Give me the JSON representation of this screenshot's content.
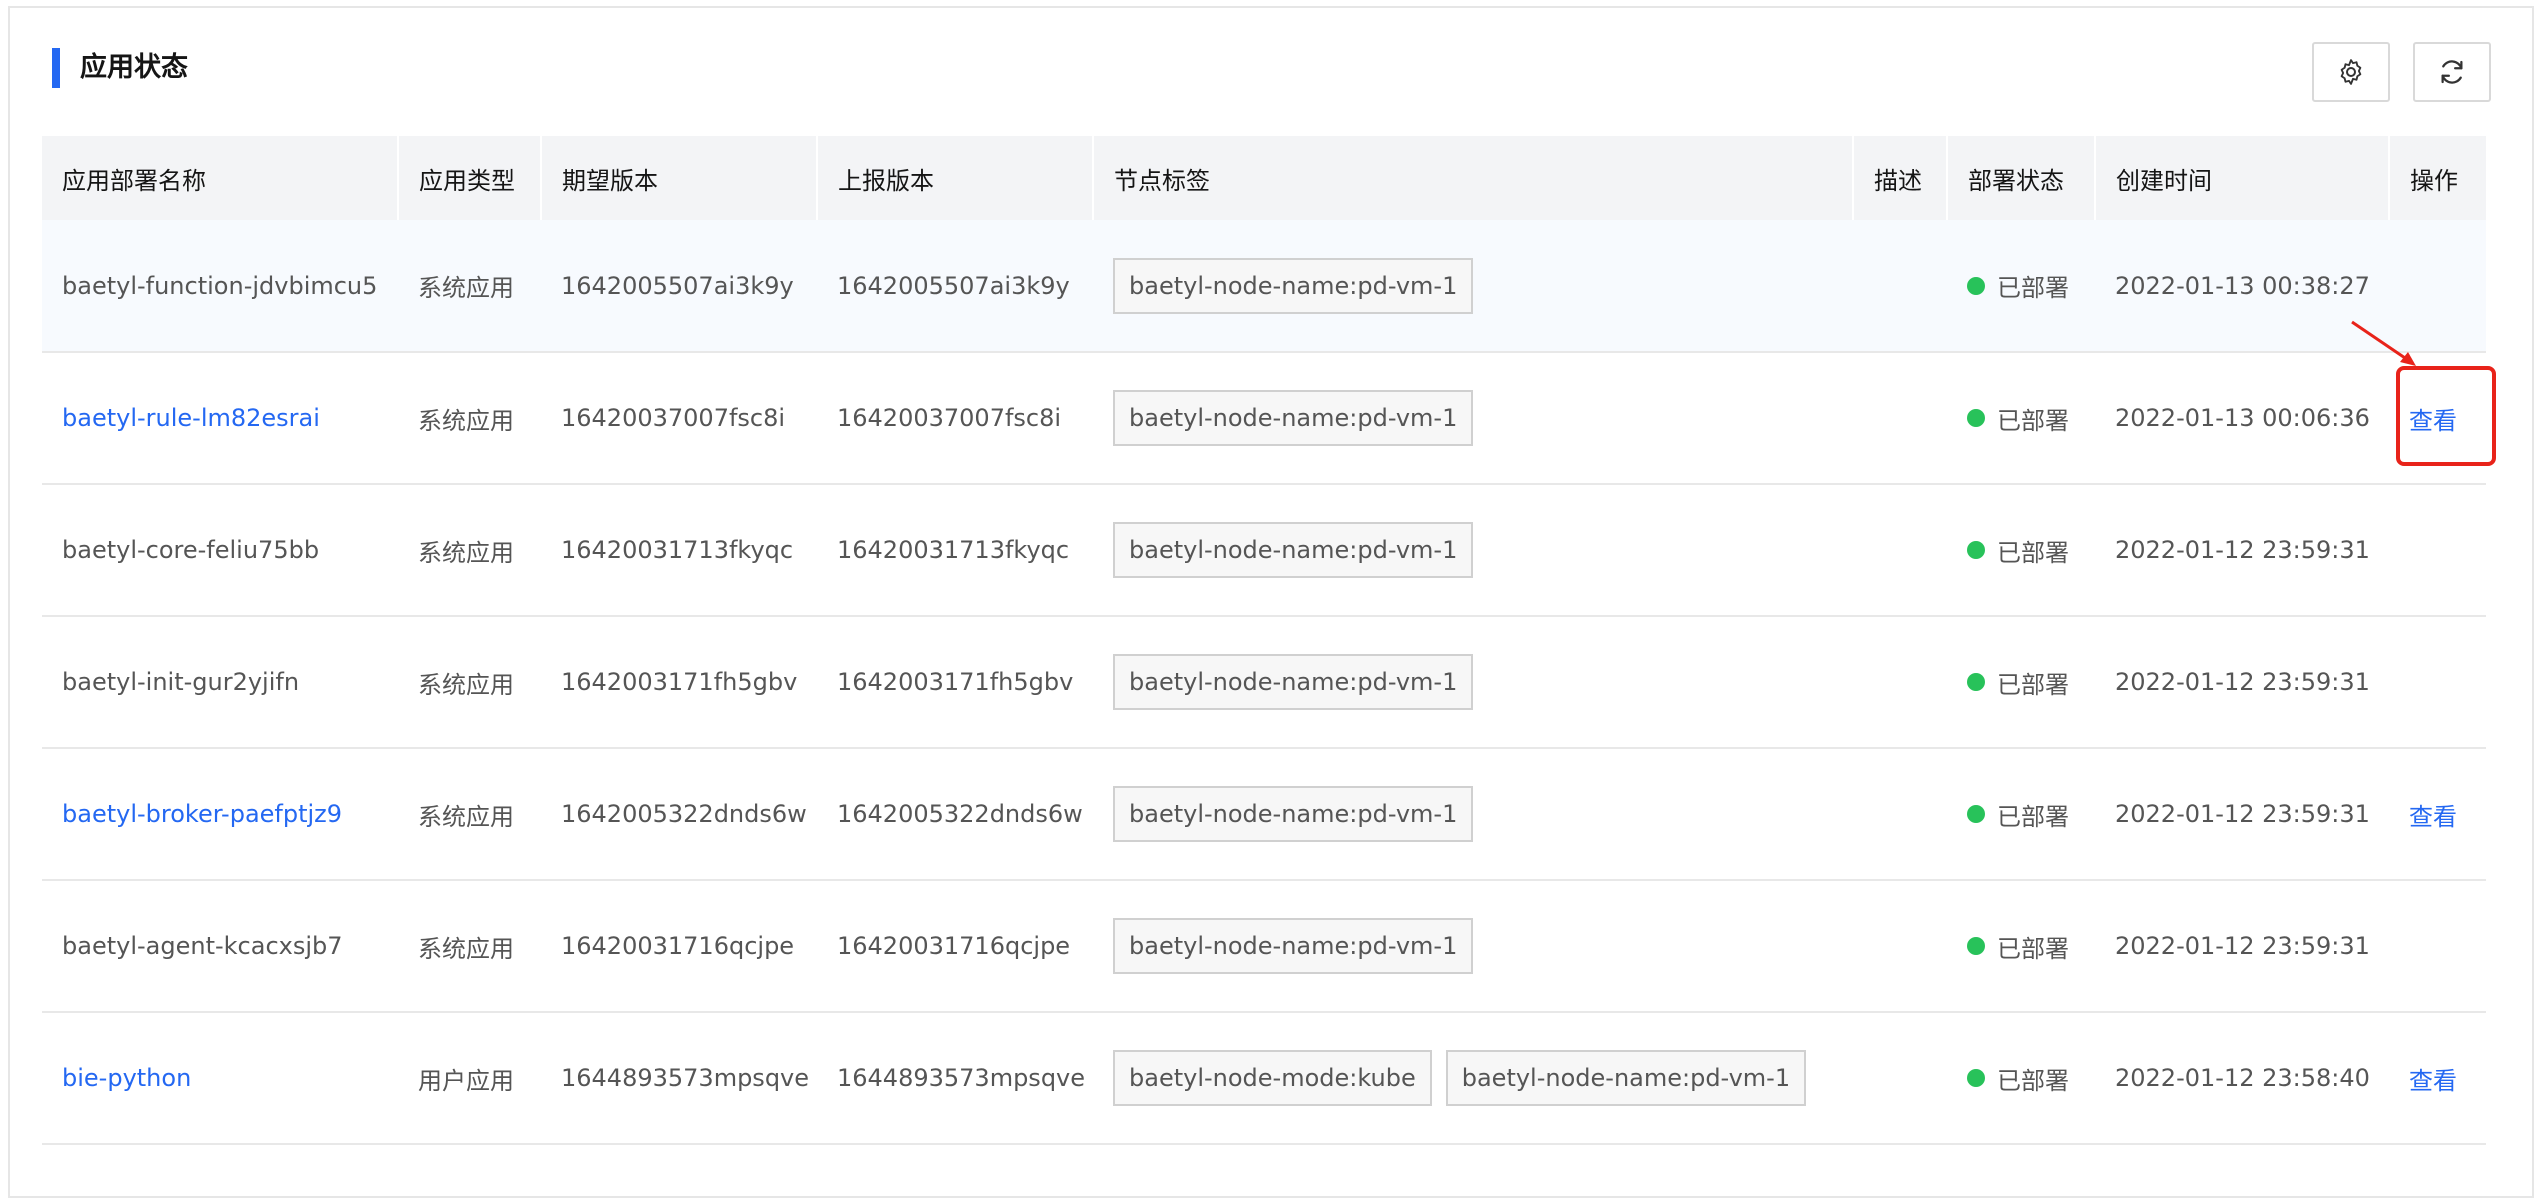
{
  "panel": {
    "title": "应用状态",
    "settings_icon": "gear-icon",
    "refresh_icon": "refresh-icon"
  },
  "table": {
    "headers": [
      "应用部署名称",
      "应用类型",
      "期望版本",
      "上报版本",
      "节点标签",
      "描述",
      "部署状态",
      "创建时间",
      "操作"
    ],
    "rows": [
      {
        "name": "baetyl-function-jdvbimcu5",
        "type": "系统应用",
        "expected": "1642005507ai3k9y",
        "reported": "1642005507ai3k9y",
        "tags": [
          "baetyl-node-name:pd-vm-1"
        ],
        "status": "已部署",
        "created": "2022-01-13 00:38:27",
        "action": ""
      },
      {
        "name": "baetyl-rule-lm82esrai",
        "type": "系统应用",
        "expected": "16420037007fsc8i",
        "reported": "16420037007fsc8i",
        "tags": [
          "baetyl-node-name:pd-vm-1"
        ],
        "status": "已部署",
        "created": "2022-01-13 00:06:36",
        "action": "查看"
      },
      {
        "name": "baetyl-core-feliu75bb",
        "type": "系统应用",
        "expected": "16420031713fkyqc",
        "reported": "16420031713fkyqc",
        "tags": [
          "baetyl-node-name:pd-vm-1"
        ],
        "status": "已部署",
        "created": "2022-01-12 23:59:31",
        "action": ""
      },
      {
        "name": "baetyl-init-gur2yjifn",
        "type": "系统应用",
        "expected": "1642003171fh5gbv",
        "reported": "1642003171fh5gbv",
        "tags": [
          "baetyl-node-name:pd-vm-1"
        ],
        "status": "已部署",
        "created": "2022-01-12 23:59:31",
        "action": ""
      },
      {
        "name": "baetyl-broker-paefptjz9",
        "type": "系统应用",
        "expected": "1642005322dnds6w",
        "reported": "1642005322dnds6w",
        "tags": [
          "baetyl-node-name:pd-vm-1"
        ],
        "status": "已部署",
        "created": "2022-01-12 23:59:31",
        "action": "查看"
      },
      {
        "name": "baetyl-agent-kcacxsjb7",
        "type": "系统应用",
        "expected": "16420031716qcjpe",
        "reported": "16420031716qcjpe",
        "tags": [
          "baetyl-node-name:pd-vm-1"
        ],
        "status": "已部署",
        "created": "2022-01-12 23:59:31",
        "action": ""
      },
      {
        "name": "bie-python",
        "type": "用户应用",
        "expected": "1644893573mpsqve",
        "reported": "1644893573mpsqve",
        "tags": [
          "baetyl-node-mode:kube",
          "baetyl-node-name:pd-vm-1"
        ],
        "status": "已部署",
        "created": "2022-01-12 23:58:40",
        "action": "查看"
      }
    ]
  },
  "colors": {
    "accent": "#2468f2",
    "status_ok": "#28c25a",
    "annotation": "#e8231a"
  }
}
